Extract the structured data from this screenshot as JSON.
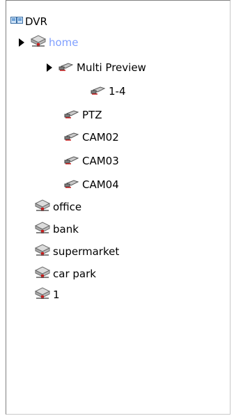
{
  "tree": {
    "root": {
      "label": "DVR",
      "icon": "dvr-icon"
    },
    "home": {
      "label": "home",
      "icon": "server-icon",
      "expanded": true,
      "selected": true
    },
    "multi_preview": {
      "label": "Multi Preview",
      "icon": "camera-icon",
      "expanded": true
    },
    "preview_1_4": {
      "label": "1-4",
      "icon": "camera-icon"
    },
    "ptz": {
      "label": "PTZ",
      "icon": "camera-icon"
    },
    "cam02": {
      "label": "CAM02",
      "icon": "camera-icon"
    },
    "cam03": {
      "label": "CAM03",
      "icon": "camera-icon"
    },
    "cam04": {
      "label": "CAM04",
      "icon": "camera-icon"
    },
    "office": {
      "label": "office",
      "icon": "server-icon"
    },
    "bank": {
      "label": "bank",
      "icon": "server-icon"
    },
    "supermarket": {
      "label": "supermarket",
      "icon": "server-icon"
    },
    "car_park": {
      "label": "car park",
      "icon": "server-icon"
    },
    "one": {
      "label": "1",
      "icon": "server-icon"
    }
  },
  "colors": {
    "selected_text": "#7f9fff",
    "panel_border": "#808080"
  }
}
